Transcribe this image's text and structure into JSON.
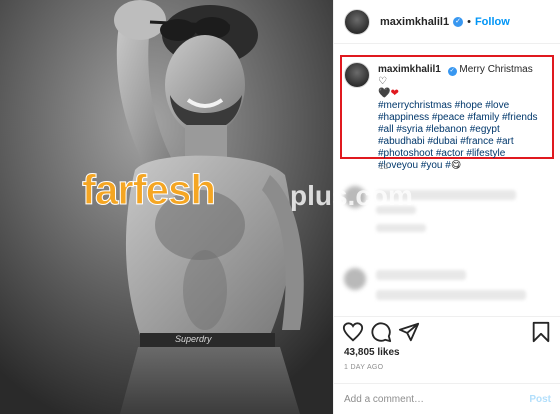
{
  "watermark": {
    "farfesh": "farfesh",
    "plus": "plus.com"
  },
  "post": {
    "username": "maximkhalil1",
    "follow_label": "Follow",
    "caption_title": "Merry Christmas",
    "hashtags": "#merrychristmas #hope #love #happiness #peace #family #friends #all #syria #lebanon #egypt #abudhabi #dubai #france #art #photoshoot #actor #lifestyle #loveyou #you #",
    "caption_time": "1d",
    "likes": "43,805 likes",
    "time_ago": "1 DAY AGO",
    "photo_brand": "Superdry",
    "comment_placeholder": "Add a comment…",
    "post_label": "Post"
  },
  "icons": {
    "heart": "heart-icon",
    "comment": "comment-icon",
    "share": "share-icon",
    "bookmark": "bookmark-icon",
    "verified": "verified-icon",
    "emoji": "face-emoji-icon"
  },
  "colors": {
    "accent": "#0095f6",
    "highlight_box": "#e0191f",
    "hashtag": "#00376b",
    "watermark_orange": "#f5a623"
  }
}
